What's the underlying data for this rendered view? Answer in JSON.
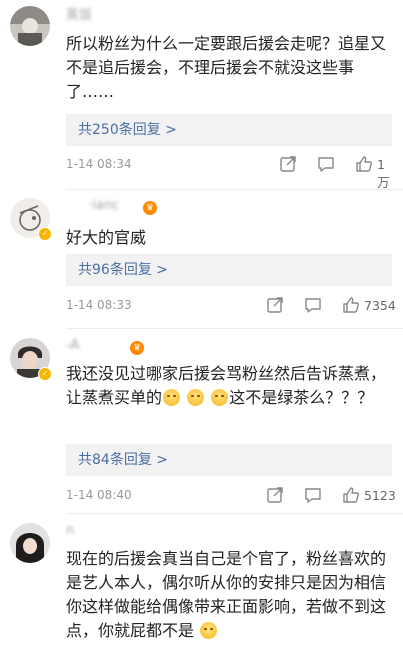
{
  "comments": [
    {
      "author": "蒸饭 ",
      "text": "所以粉丝为什么一定要跟后援会走呢？追星又不是追后援会，不理后援会不就没这些事了……",
      "reply_label": "共250条回复 >",
      "time": "1-14 08:34",
      "likes": "1万",
      "verified": false
    },
    {
      "author": "·ianc",
      "text": "好大的官威",
      "reply_label": "共96条回复 >",
      "time": "1-14 08:33",
      "likes": "7354",
      "verified": true
    },
    {
      "author": "-A",
      "text_before": "我还没见过哪家后援会骂粉丝然后告诉蒸煮，让蒸煮买单的",
      "text_after": "这不是绿茶么？？？",
      "reply_label": "共84条回复 >",
      "time": "1-14 08:40",
      "likes": "5123",
      "verified": true
    },
    {
      "author": "n",
      "text": "现在的后援会真当自己是个官了，粉丝喜欢的是艺人本人，偶尔听从你的安排只是因为相信你这样做能给偶像带来正面影响，若做不到这点，你就屁都不是",
      "verified": false
    }
  ],
  "icons": {
    "share": "share-icon",
    "comment": "comment-icon",
    "like": "thumbs-up-icon",
    "verified": "verified-badge-icon",
    "emoji": "smile-emoji-icon"
  }
}
